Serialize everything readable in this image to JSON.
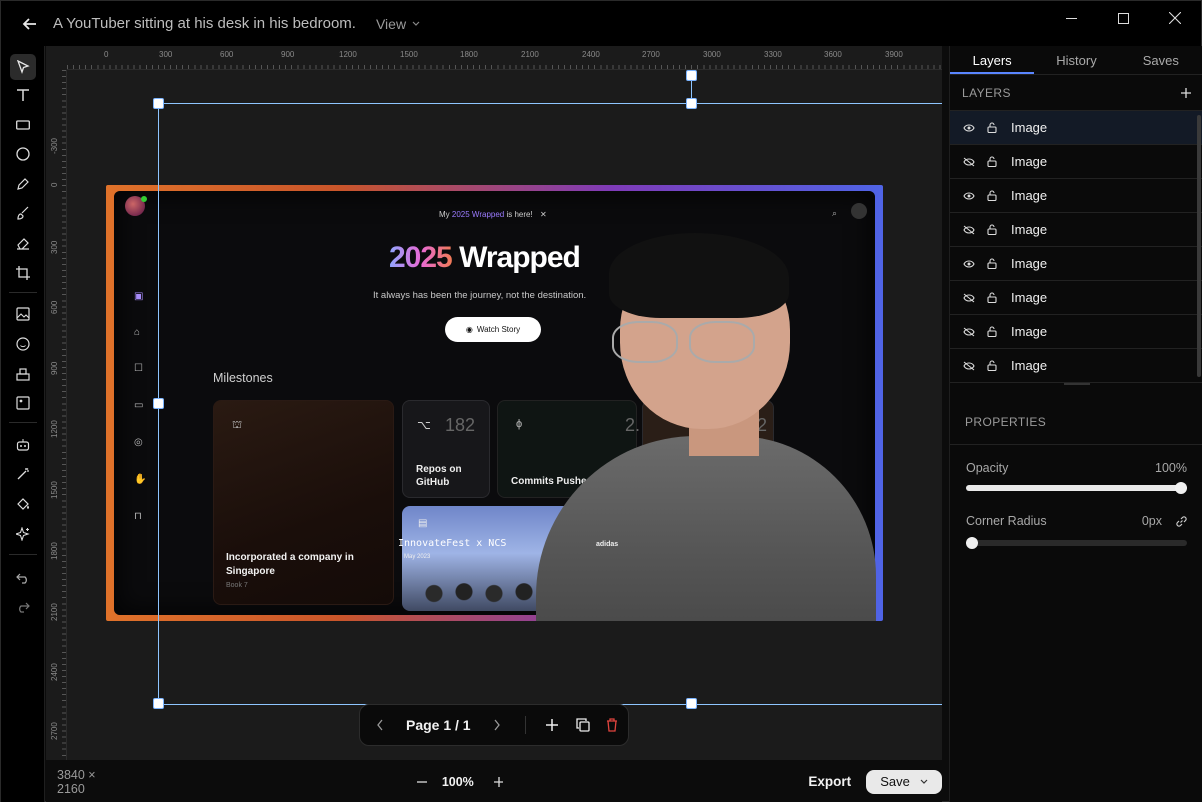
{
  "window": {
    "title": "A YouTuber sitting at his desk in his bedroom.",
    "view_menu": "View"
  },
  "toolbar": {
    "tools": [
      "select-tool",
      "text-tool",
      "rectangle-tool",
      "ellipse-tool",
      "pen-tool",
      "brush-tool",
      "eraser-tool",
      "crop-tool",
      "image-tool",
      "emoji-tool",
      "stamp-tool",
      "photo-edit-tool",
      "robot-tool",
      "magic-wand-tool",
      "paint-bucket-tool",
      "sparkle-tool",
      "undo",
      "redo"
    ]
  },
  "ruler": {
    "top": [
      "0",
      "300",
      "600",
      "900",
      "1200",
      "1500",
      "1800",
      "2100",
      "2400",
      "2700",
      "3000",
      "3300",
      "3600",
      "3900"
    ],
    "left": [
      "-300",
      "0",
      "300",
      "600",
      "900",
      "1200",
      "1500",
      "1800",
      "2100",
      "2400",
      "2700"
    ]
  },
  "artwork": {
    "badge": "My",
    "badge_highlight": "2025 Wrapped",
    "badge_tail": "is here!",
    "headline_year": "2025",
    "headline_word": "Wrapped",
    "subtitle": "It always has been the journey, not the destination.",
    "watch_button": "Watch Story",
    "milestones_title": "Milestones",
    "card_company": "Incorporated a company in Singapore",
    "card_company_sub": "Book 7",
    "card_repos_num": "182",
    "card_repos_label": "Repos on GitHub",
    "card_commits_label": "Commits Pushed",
    "card_commits_num_partial": "2.",
    "card_right_num_partial": "82",
    "card_event": "InnovateFest x NCS",
    "card_event_sub": "May 2023",
    "shirt_logo": "adidas"
  },
  "pager": {
    "label": "Page 1 / 1"
  },
  "status": {
    "dimensions": "3840 × 2160",
    "zoom": "100%",
    "export": "Export",
    "save": "Save"
  },
  "panel": {
    "tabs": [
      "Layers",
      "History",
      "Saves"
    ],
    "layers_heading": "LAYERS",
    "layers": [
      {
        "name": "Image",
        "visible": true
      },
      {
        "name": "Image",
        "visible": false
      },
      {
        "name": "Image",
        "visible": true
      },
      {
        "name": "Image",
        "visible": false
      },
      {
        "name": "Image",
        "visible": true
      },
      {
        "name": "Image",
        "visible": false
      },
      {
        "name": "Image",
        "visible": false
      },
      {
        "name": "Image",
        "visible": false
      }
    ],
    "properties_heading": "PROPERTIES",
    "opacity_label": "Opacity",
    "opacity_value": "100%",
    "opacity_level": 1.0,
    "radius_label": "Corner Radius",
    "radius_value": "0px",
    "radius_level": 0.0
  },
  "colors": {
    "accent": "#5a86ff",
    "selection": "#8ec5ff",
    "delete": "#e0443e"
  }
}
